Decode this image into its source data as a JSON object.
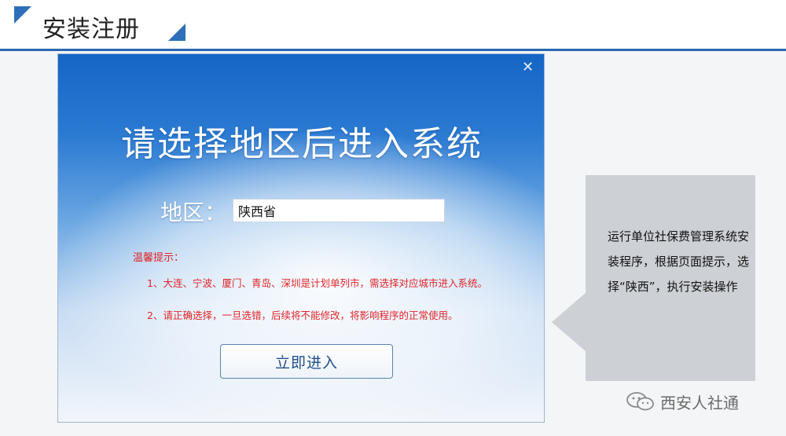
{
  "slide": {
    "title": "安装注册",
    "accent_color": "#2d6fb8"
  },
  "installer": {
    "heading": "请选择地区后进入系统",
    "region_label": "地区：",
    "region_value": "陕西省",
    "tips_title": "温馨提示：",
    "tips": [
      "1、大连、宁波、厦门、青岛、深圳是计划单列市，需选择对应城市进入系统。",
      "2、请正确选择，一旦选错，后续将不能修改，将影响程序的正常使用。"
    ],
    "enter_button_label": "立即进入",
    "close_icon": "close-icon"
  },
  "callout": {
    "text": "运行单位社保费管理系统安装程序，根据页面提示，选择“陕西”，执行安装操作"
  },
  "watermark": {
    "text": "西安人社通",
    "icon": "wechat-icon"
  }
}
